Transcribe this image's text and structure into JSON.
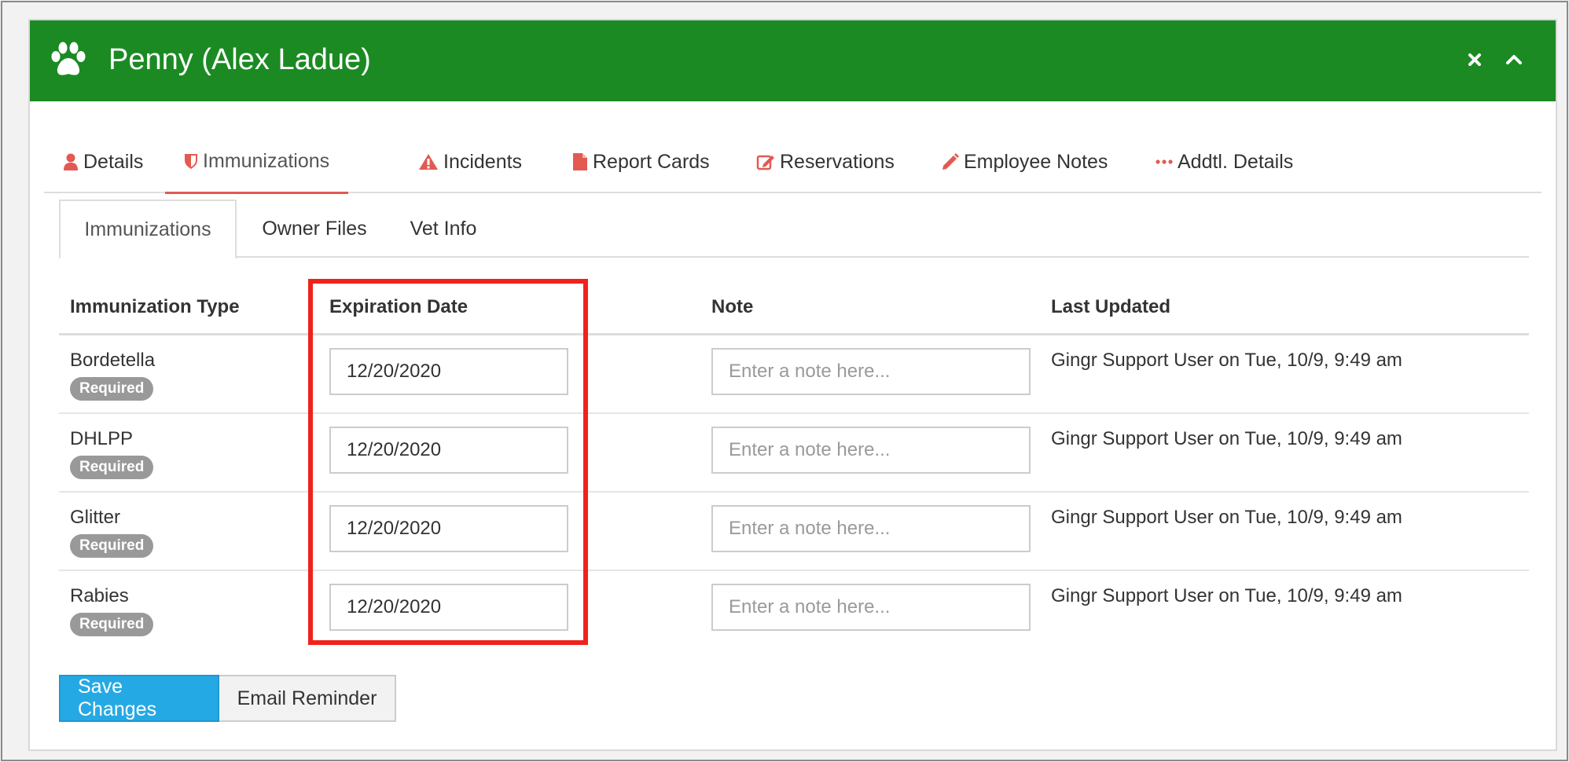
{
  "header": {
    "title": "Penny (Alex Ladue)",
    "bg_color": "#1b8a23",
    "icon": "paw-icon"
  },
  "tabs": [
    {
      "label": "Details",
      "icon": "user-icon"
    },
    {
      "label": "Immunizations",
      "icon": "shield-icon",
      "active": true
    },
    {
      "label": "Incidents",
      "icon": "warning-icon"
    },
    {
      "label": "Report Cards",
      "icon": "file-icon"
    },
    {
      "label": "Reservations",
      "icon": "edit-icon"
    },
    {
      "label": "Employee Notes",
      "icon": "pencil-icon"
    },
    {
      "label": "Addtl. Details",
      "icon": "ellipsis-icon"
    }
  ],
  "subtabs": [
    {
      "label": "Immunizations",
      "active": true
    },
    {
      "label": "Owner Files"
    },
    {
      "label": "Vet Info"
    }
  ],
  "table": {
    "headers": {
      "type": "Immunization Type",
      "expiration": "Expiration Date",
      "note": "Note",
      "updated": "Last Updated"
    },
    "rows": [
      {
        "type": "Bordetella",
        "badge": "Required",
        "expiration": "12/20/2020",
        "note": "",
        "note_placeholder": "Enter a note here...",
        "updated": "Gingr Support User on Tue, 10/9, 9:49 am"
      },
      {
        "type": "DHLPP",
        "badge": "Required",
        "expiration": "12/20/2020",
        "note": "",
        "note_placeholder": "Enter a note here...",
        "updated": "Gingr Support User on Tue, 10/9, 9:49 am"
      },
      {
        "type": "Glitter",
        "badge": "Required",
        "expiration": "12/20/2020",
        "note": "",
        "note_placeholder": "Enter a note here...",
        "updated": "Gingr Support User on Tue, 10/9, 9:49 am"
      },
      {
        "type": "Rabies",
        "badge": "Required",
        "expiration": "12/20/2020",
        "note": "",
        "note_placeholder": "Enter a note here...",
        "updated": "Gingr Support User on Tue, 10/9, 9:49 am"
      }
    ]
  },
  "actions": {
    "save_label": "Save Changes",
    "email_label": "Email Reminder"
  },
  "colors": {
    "accent_red": "#e25a52",
    "save_blue": "#25a9e4",
    "highlight_red": "#f0221c",
    "badge_gray": "#999999"
  }
}
